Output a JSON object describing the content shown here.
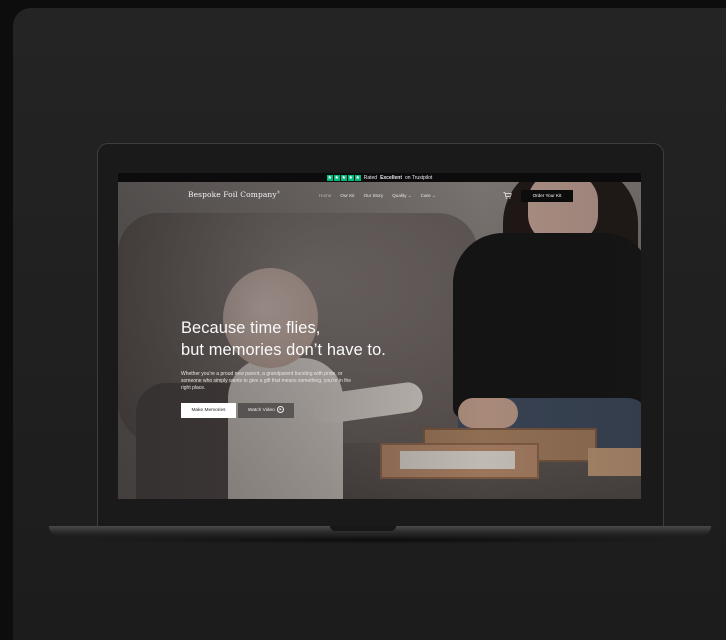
{
  "trustbar": {
    "rated": "Rated",
    "rating": "Excellent",
    "on": "on Trustpilot",
    "star_glyph": "★",
    "star_color": "#00b67a"
  },
  "nav": {
    "logo": "Bespoke Foil Company",
    "logo_mark": "®",
    "items": [
      {
        "label": "Home"
      },
      {
        "label": "Our Kit"
      },
      {
        "label": "Our Story"
      },
      {
        "label": "Quality ⌄"
      },
      {
        "label": "Care ⌄"
      }
    ],
    "cart_icon": "cart-icon",
    "order_label": "Order Your Kit"
  },
  "hero": {
    "title_line1": "Because time flies,",
    "title_line2": "but memories don’t have to.",
    "subtitle": "Whether you’re a proud new parent, a grandparent bursting with pride, or someone who simply wants to give a gift that means something, you’re in the right place.",
    "primary_label": "Make Memories",
    "video_label": "Watch Video",
    "play_icon": "play-icon"
  },
  "colors": {
    "background": "#0d0d0d",
    "card": "#232323",
    "button_dark": "#0c0c0c",
    "button_light": "#ffffff"
  }
}
